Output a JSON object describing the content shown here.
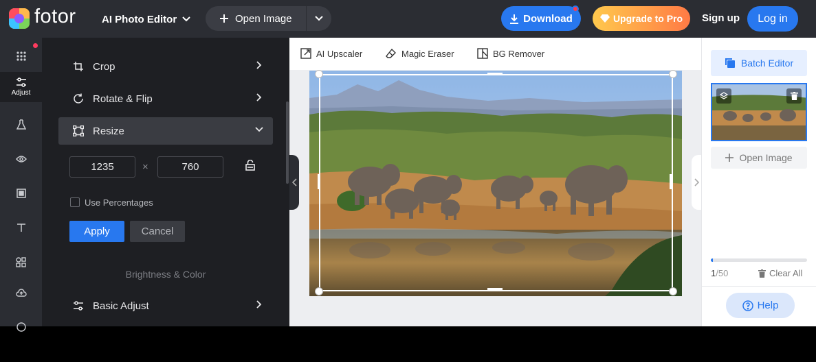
{
  "header": {
    "logo_text": "fotor",
    "product_menu": "AI Photo Editor",
    "open_image": "Open Image",
    "download": "Download",
    "upgrade": "Upgrade to Pro",
    "signup": "Sign up",
    "login": "Log in"
  },
  "rail": {
    "items": [
      {
        "icon": "grid-icon",
        "label": ""
      },
      {
        "icon": "sliders-icon",
        "label": "Adjust"
      },
      {
        "icon": "flask-icon",
        "label": ""
      },
      {
        "icon": "eye-icon",
        "label": ""
      },
      {
        "icon": "frame-icon",
        "label": ""
      },
      {
        "icon": "text-icon",
        "label": ""
      },
      {
        "icon": "elements-icon",
        "label": ""
      },
      {
        "icon": "cloud-icon",
        "label": ""
      }
    ]
  },
  "panel": {
    "crop": "Crop",
    "rotate": "Rotate & Flip",
    "resize": "Resize",
    "width": "1235",
    "height": "760",
    "times": "×",
    "use_percentages": "Use Percentages",
    "apply": "Apply",
    "cancel": "Cancel",
    "section_brightness": "Brightness & Color",
    "basic_adjust": "Basic Adjust"
  },
  "tools": {
    "upscaler": "AI Upscaler",
    "eraser": "Magic Eraser",
    "bg_remover": "BG Remover"
  },
  "right": {
    "batch_editor": "Batch Editor",
    "open_image": "Open Image",
    "count_current": "1",
    "count_total": "/50",
    "progress_fraction": 0.02,
    "clear_all": "Clear All",
    "help": "Help"
  },
  "colors": {
    "accent": "#2878ef",
    "topbar": "#2b2d33",
    "panel": "#1e1f23"
  }
}
